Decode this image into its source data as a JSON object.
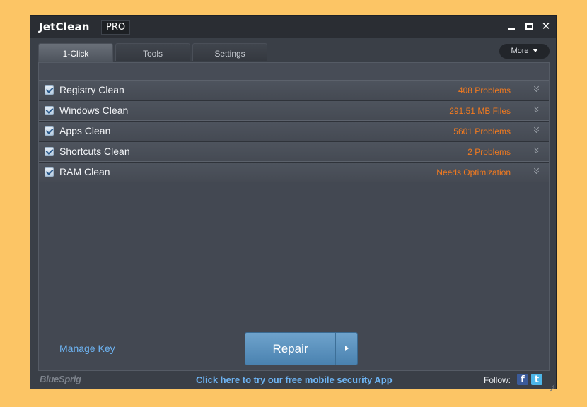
{
  "app": {
    "title": "JetClean",
    "edition": "PRO"
  },
  "window_controls": {
    "minimize": "minimize",
    "maximize": "maximize",
    "close": "✕"
  },
  "tabs": [
    {
      "label": "1-Click",
      "active": true
    },
    {
      "label": "Tools",
      "active": false
    },
    {
      "label": "Settings",
      "active": false
    }
  ],
  "more_button": {
    "label": "More"
  },
  "items": [
    {
      "label": "Registry Clean",
      "status": "408  Problems",
      "checked": true
    },
    {
      "label": "Windows Clean",
      "status": "291.51 MB  Files",
      "checked": true
    },
    {
      "label": "Apps Clean",
      "status": "5601  Problems",
      "checked": true
    },
    {
      "label": "Shortcuts Clean",
      "status": "2  Problems",
      "checked": true
    },
    {
      "label": "RAM Clean",
      "status": "Needs Optimization",
      "checked": true
    }
  ],
  "manage_key": {
    "label": "Manage Key"
  },
  "repair_button": {
    "label": "Repair"
  },
  "footer": {
    "brand": "BlueSprig",
    "promo_link": "Click here to try our free mobile security App",
    "follow_label": "Follow:",
    "facebook": "f",
    "twitter": "t"
  },
  "colors": {
    "background": "#FCC565",
    "window": "#3A3F47",
    "status_orange": "#F27A1F",
    "link_blue": "#6DB3F2",
    "repair_blue": "#5A93C0"
  }
}
